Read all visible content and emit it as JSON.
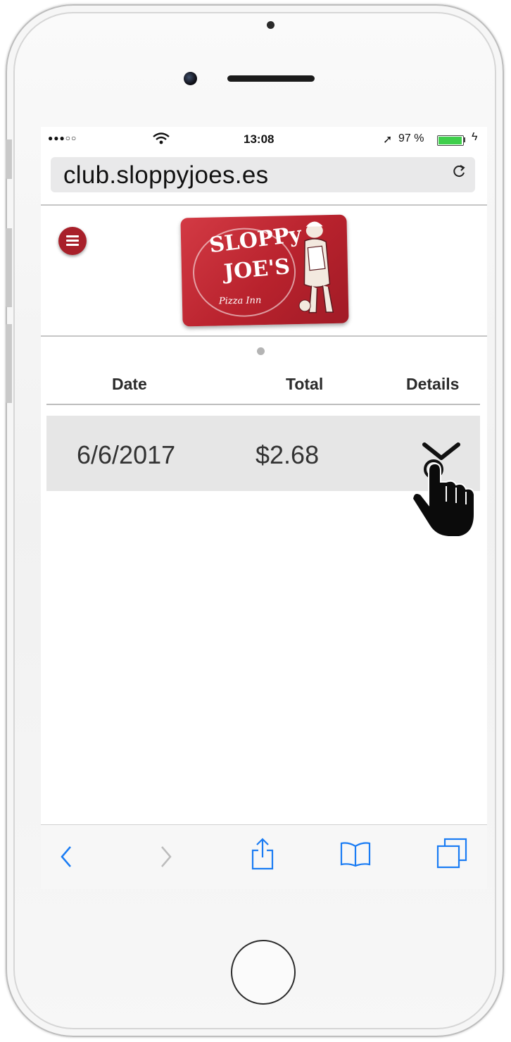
{
  "status_bar": {
    "signal": "●●●○○",
    "time": "13:08",
    "battery_percent": "97 %",
    "battery_level": 0.97,
    "icons": [
      "wifi-icon",
      "location-arrow-icon",
      "battery-icon",
      "charging-bolt-icon"
    ]
  },
  "browser": {
    "url": "club.sloppyjoes.es",
    "reload_icon": "reload-icon"
  },
  "header": {
    "menu_icon": "hamburger-menu-icon",
    "logo": {
      "line1": "SLOPPy",
      "line2": "JOE'S",
      "line3": "Pizza Inn"
    }
  },
  "table": {
    "columns": [
      "Date",
      "Total",
      "Details"
    ],
    "rows": [
      {
        "date": "6/6/2017",
        "total": "$2.68",
        "details_icon": "chevron-down-icon"
      }
    ]
  },
  "toolbar": {
    "icons": [
      "back-icon",
      "forward-icon",
      "share-icon",
      "bookmarks-icon",
      "tabs-icon"
    ]
  },
  "colors": {
    "brand_red": "#b8222d",
    "ios_blue": "#1a7cf4",
    "battery_green": "#3fcf4c",
    "row_bg": "#e6e6e6"
  }
}
